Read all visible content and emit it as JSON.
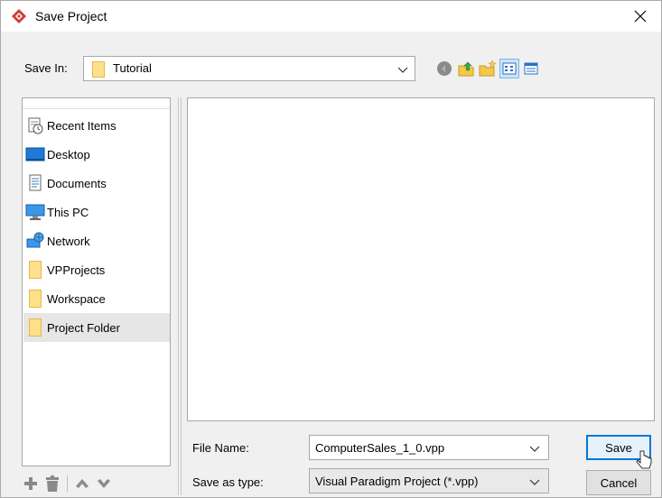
{
  "window": {
    "title": "Save Project",
    "close_label": "×"
  },
  "save_in": {
    "label": "Save In:",
    "value": "Tutorial"
  },
  "toolbar": {
    "icons": [
      "back-icon",
      "up-folder-icon",
      "new-folder-icon",
      "list-view-icon",
      "details-view-icon"
    ]
  },
  "places": {
    "items": [
      {
        "label": "Recent Items",
        "icon": "recent-items-icon"
      },
      {
        "label": "Desktop",
        "icon": "desktop-icon"
      },
      {
        "label": "Documents",
        "icon": "documents-icon"
      },
      {
        "label": "This PC",
        "icon": "this-pc-icon"
      },
      {
        "label": "Network",
        "icon": "network-icon"
      },
      {
        "label": "VPProjects",
        "icon": "folder-icon"
      },
      {
        "label": "Workspace",
        "icon": "folder-icon"
      },
      {
        "label": "Project Folder",
        "icon": "folder-icon",
        "selected": true
      }
    ]
  },
  "form": {
    "file_name_label": "File Name:",
    "file_name_value": "ComputerSales_1_0.vpp",
    "type_label": "Save as type:",
    "type_value": "Visual Paradigm Project (*.vpp)"
  },
  "buttons": {
    "save": "Save",
    "cancel": "Cancel"
  },
  "colors": {
    "accent": "#0078d7",
    "folder": "#ffe08a",
    "selected": "#e6e6e6"
  }
}
